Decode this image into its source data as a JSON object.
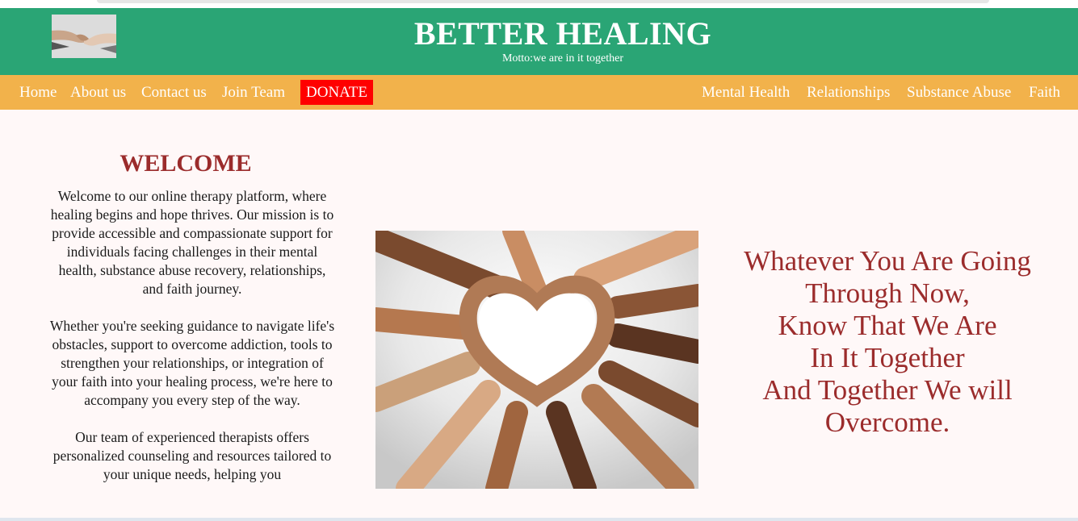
{
  "header": {
    "title": "BETTER HEALING",
    "motto": "Motto:we are in it together"
  },
  "nav": {
    "left": [
      "Home",
      "About us",
      "Contact us",
      "Join Team"
    ],
    "donate": "DONATE",
    "right": [
      "Mental Health",
      "Relationships",
      "Substance Abuse",
      "Faith"
    ]
  },
  "welcome": {
    "title": "WELCOME",
    "paragraphs": [
      "Welcome to our online therapy platform, where healing begins and hope thrives. Our mission is to provide accessible and compassionate support for individuals facing challenges in their mental health, substance abuse recovery, relationships, and faith journey.",
      "Whether you're seeking guidance to navigate life's obstacles, support to overcome addiction, tools to strengthen your relationships, or integration of your faith into your healing process, we're here to accompany you every step of the way.",
      "Our team of experienced therapists offers personalized counseling and resources tailored to your unique needs, helping you"
    ]
  },
  "quote": {
    "lines": [
      "Whatever You Are Going",
      "Through Now,",
      "Know That We Are",
      "In It Together",
      "And Together We will",
      "Overcome."
    ]
  },
  "colors": {
    "header_bg": "#2aa575",
    "nav_bg": "#f2b24b",
    "donate_bg": "#ff0000",
    "accent_text": "#9b2c2c",
    "main_bg": "#fff8f8"
  }
}
